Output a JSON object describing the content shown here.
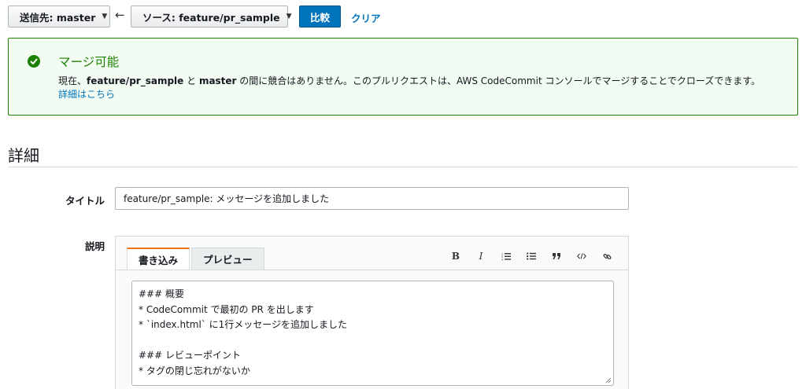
{
  "toolbar": {
    "destination_label": "送信先: master",
    "arrow": "←",
    "source_label": "ソース: feature/pr_sample",
    "compare_label": "比較",
    "clear_label": "クリア"
  },
  "alert": {
    "title": "マージ可能",
    "message_parts": [
      "現在、",
      "feature/pr_sample",
      " と ",
      "master",
      " の間に競合はありません。このプルリクエストは、AWS CodeCommit コンソールでマージすることでクローズできます。"
    ],
    "link": "詳細はこちら"
  },
  "details": {
    "section_title": "詳細",
    "title_label": "タイトル",
    "title_value": "feature/pr_sample: メッセージを追加しました",
    "description_label": "説明",
    "tabs": [
      "書き込み",
      "プレビュー"
    ],
    "tools": {
      "bold": "B",
      "italic": "I",
      "ordered_list": "ordered-list-icon",
      "unordered_list": "unordered-list-icon",
      "quote": "quote-icon",
      "code": "code-icon",
      "link": "link-icon"
    },
    "description_lines": [
      "### 概要",
      "* CodeCommit で最初の PR を出します",
      "* `index.html` に1行メッセージを追加しました",
      "",
      "### レビューポイント",
      "* タグの閉じ忘れがないか"
    ]
  },
  "colors": {
    "primary": "#0073bb",
    "success": "#1d8102",
    "success_bg": "#f2fcf3",
    "tab_accent": "#ec7211"
  }
}
